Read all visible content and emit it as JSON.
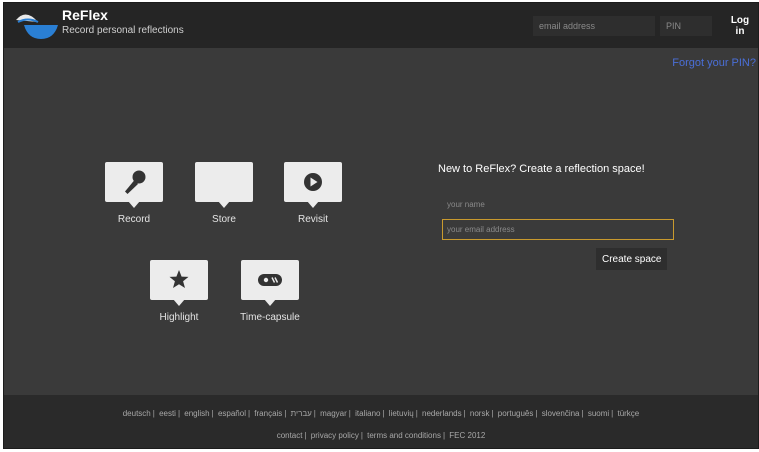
{
  "header": {
    "app_title": "ReFlex",
    "app_subtitle": "Record personal reflections",
    "email_placeholder": "email address",
    "pin_placeholder": "PIN",
    "login_label": "Log in",
    "forgot_label": "Forgot your PIN?"
  },
  "features": {
    "record": {
      "label": "Record",
      "icon": "microphone-icon"
    },
    "store": {
      "label": "Store",
      "icon": "screen-icon"
    },
    "revisit": {
      "label": "Revisit",
      "icon": "play-icon"
    },
    "highlight": {
      "label": "Highlight",
      "icon": "star-icon"
    },
    "timecapsule": {
      "label": "Time-capsule",
      "icon": "capsule-icon"
    }
  },
  "signup": {
    "heading": "New to ReFlex? Create a reflection space!",
    "name_placeholder": "your name",
    "email_placeholder": "your email address",
    "create_label": "Create space"
  },
  "footer": {
    "languages": [
      "deutsch",
      "eesti",
      "english",
      "español",
      "français",
      "עברית",
      "magyar",
      "italiano",
      "lietuvių",
      "nederlands",
      "norsk",
      "português",
      "slovenčina",
      "suomi",
      "türkçe"
    ],
    "links": [
      "contact",
      "privacy policy",
      "terms and conditions",
      "FEC 2012"
    ]
  },
  "colors": {
    "background": "#3a3a3a",
    "header": "#252525",
    "accent_blue": "#4a6fd8",
    "focus_border": "#c99a2e"
  }
}
